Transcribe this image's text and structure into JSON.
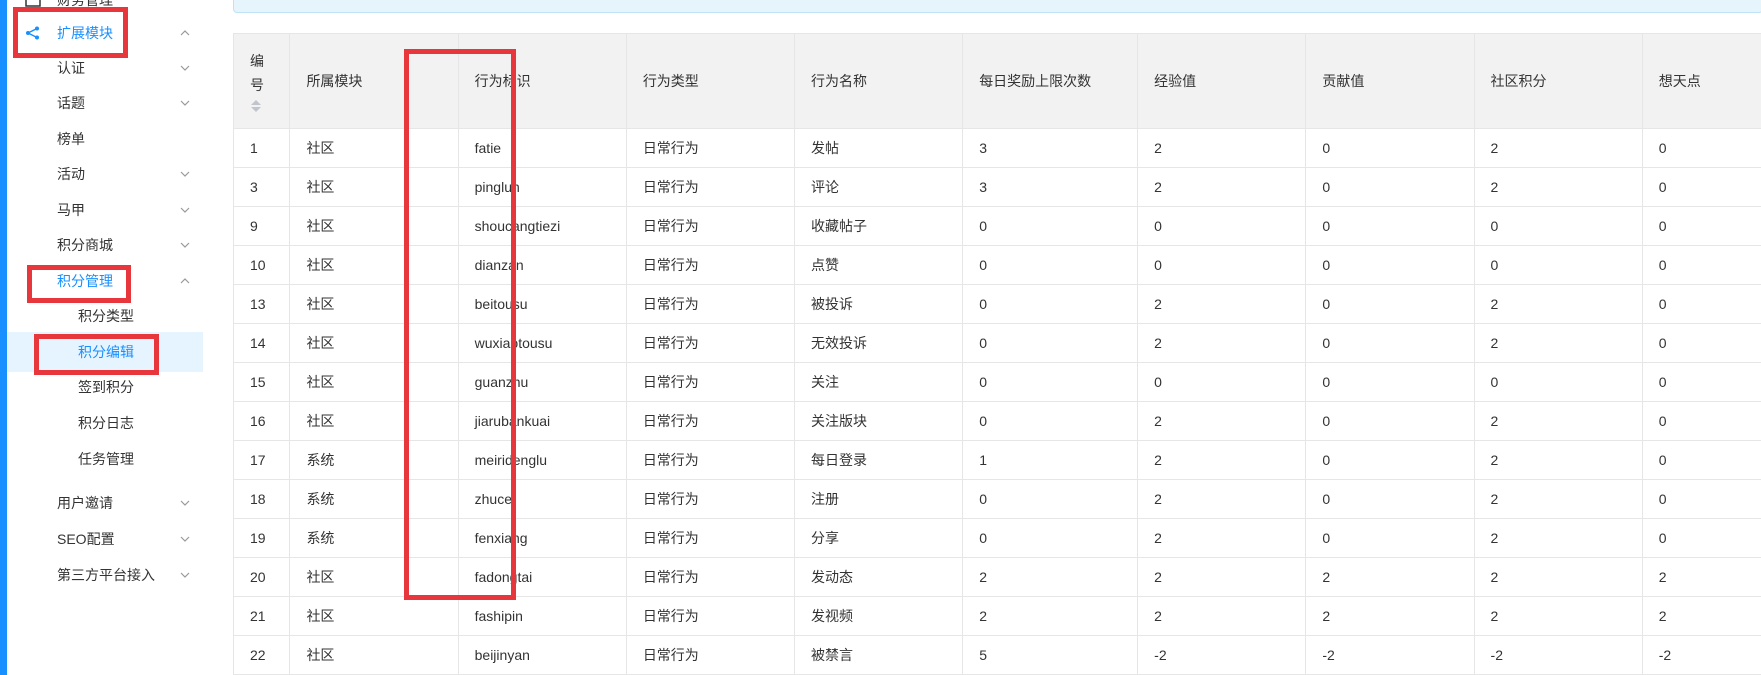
{
  "sidebar": {
    "top_item": "财务管理",
    "items": [
      {
        "label": "扩展模块",
        "chevron": "up",
        "active": true,
        "icon": "share-icon"
      },
      {
        "label": "认证",
        "chevron": "down"
      },
      {
        "label": "话题",
        "chevron": "down"
      },
      {
        "label": "榜单",
        "chevron": ""
      },
      {
        "label": "活动",
        "chevron": "down"
      },
      {
        "label": "马甲",
        "chevron": "down"
      },
      {
        "label": "积分商城",
        "chevron": "down"
      },
      {
        "label": "积分管理",
        "chevron": "up",
        "active": true
      },
      {
        "label": "积分类型",
        "sub": true
      },
      {
        "label": "积分编辑",
        "sub": true,
        "selected": true
      },
      {
        "label": "签到积分",
        "sub": true
      },
      {
        "label": "积分日志",
        "sub": true
      },
      {
        "label": "任务管理",
        "sub": true
      },
      {
        "label": "用户邀请",
        "chevron": "down"
      },
      {
        "label": "SEO配置",
        "chevron": "down"
      },
      {
        "label": "第三方平台接入",
        "chevron": "down"
      }
    ]
  },
  "colors": {
    "accent": "#1890ff",
    "highlight": "#e8363d"
  },
  "table": {
    "id_header_chars": [
      "编",
      "号"
    ],
    "headers": [
      "所属模块",
      "行为标识",
      "行为类型",
      "行为名称",
      "每日奖励上限次数",
      "经验值",
      "贡献值",
      "社区积分",
      "想天点"
    ],
    "rows": [
      [
        "1",
        "社区",
        "fatie",
        "日常行为",
        "发帖",
        "3",
        "2",
        "0",
        "2",
        "0"
      ],
      [
        "3",
        "社区",
        "pinglun",
        "日常行为",
        "评论",
        "3",
        "2",
        "0",
        "2",
        "0"
      ],
      [
        "9",
        "社区",
        "shoucangtiezi",
        "日常行为",
        "收藏帖子",
        "0",
        "0",
        "0",
        "0",
        "0"
      ],
      [
        "10",
        "社区",
        "dianzan",
        "日常行为",
        "点赞",
        "0",
        "0",
        "0",
        "0",
        "0"
      ],
      [
        "13",
        "社区",
        "beitousu",
        "日常行为",
        "被投诉",
        "0",
        "2",
        "0",
        "2",
        "0"
      ],
      [
        "14",
        "社区",
        "wuxiaotousu",
        "日常行为",
        "无效投诉",
        "0",
        "2",
        "0",
        "2",
        "0"
      ],
      [
        "15",
        "社区",
        "guanzhu",
        "日常行为",
        "关注",
        "0",
        "0",
        "0",
        "0",
        "0"
      ],
      [
        "16",
        "社区",
        "jiarubankuai",
        "日常行为",
        "关注版块",
        "0",
        "2",
        "0",
        "2",
        "0"
      ],
      [
        "17",
        "系统",
        "meiridenglu",
        "日常行为",
        "每日登录",
        "1",
        "2",
        "0",
        "2",
        "0"
      ],
      [
        "18",
        "系统",
        "zhuce",
        "日常行为",
        "注册",
        "0",
        "2",
        "0",
        "2",
        "0"
      ],
      [
        "19",
        "系统",
        "fenxiang",
        "日常行为",
        "分享",
        "0",
        "2",
        "0",
        "2",
        "0"
      ],
      [
        "20",
        "社区",
        "fadongtai",
        "日常行为",
        "发动态",
        "2",
        "2",
        "2",
        "2",
        "2"
      ],
      [
        "21",
        "社区",
        "fashipin",
        "日常行为",
        "发视频",
        "2",
        "2",
        "2",
        "2",
        "2"
      ],
      [
        "22",
        "社区",
        "beijinyan",
        "日常行为",
        "被禁言",
        "5",
        "-2",
        "-2",
        "-2",
        "-2"
      ]
    ]
  }
}
